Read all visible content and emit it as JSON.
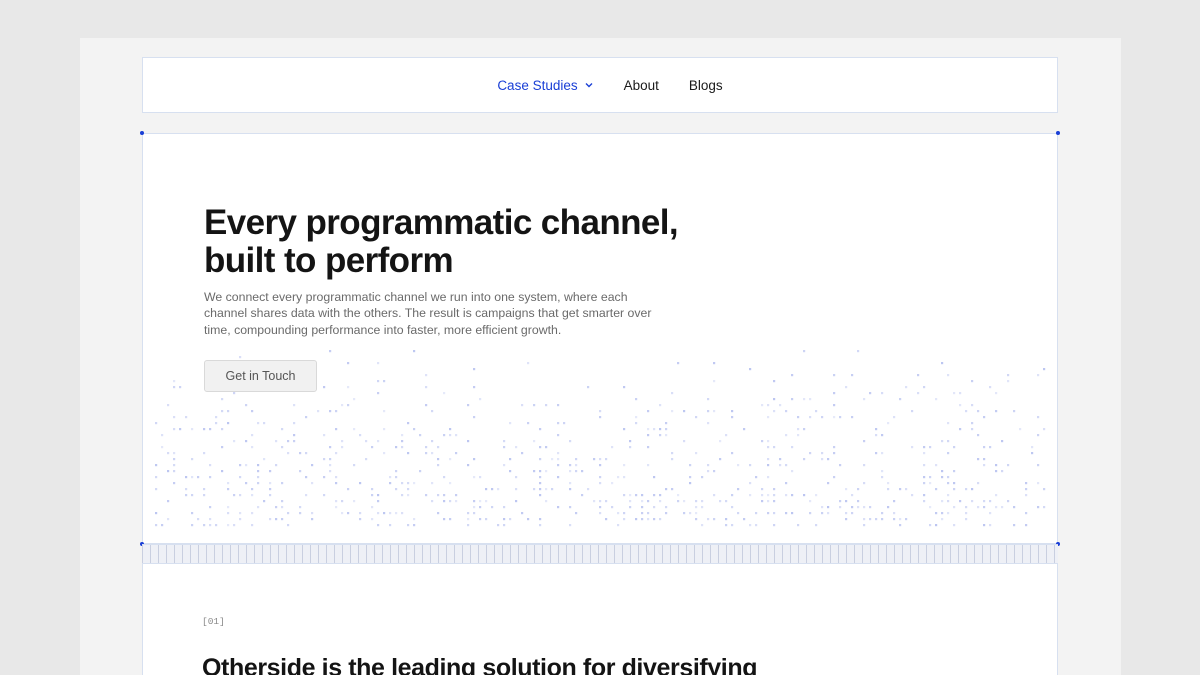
{
  "nav": {
    "items": [
      {
        "label": "Case Studies",
        "active": true,
        "has_dropdown": true
      },
      {
        "label": "About",
        "active": false
      },
      {
        "label": "Blogs",
        "active": false
      }
    ]
  },
  "hero": {
    "title_line1": "Every programmatic channel,",
    "title_line2": "built to perform",
    "description": "We connect every programmatic channel we run into one system, where each channel shares data with the others. The result is campaigns that get smarter over time, compounding performance into faster, more efficient growth.",
    "cta_label": "Get in Touch"
  },
  "section": {
    "number": "[01]",
    "title": "Otherside is the leading solution for diversifying"
  },
  "colors": {
    "accent": "#1a3fd6",
    "background": "#e8e8e8",
    "panel": "#ffffff",
    "border": "#d7e0f0",
    "dot_pattern": "#b8c2f0"
  }
}
